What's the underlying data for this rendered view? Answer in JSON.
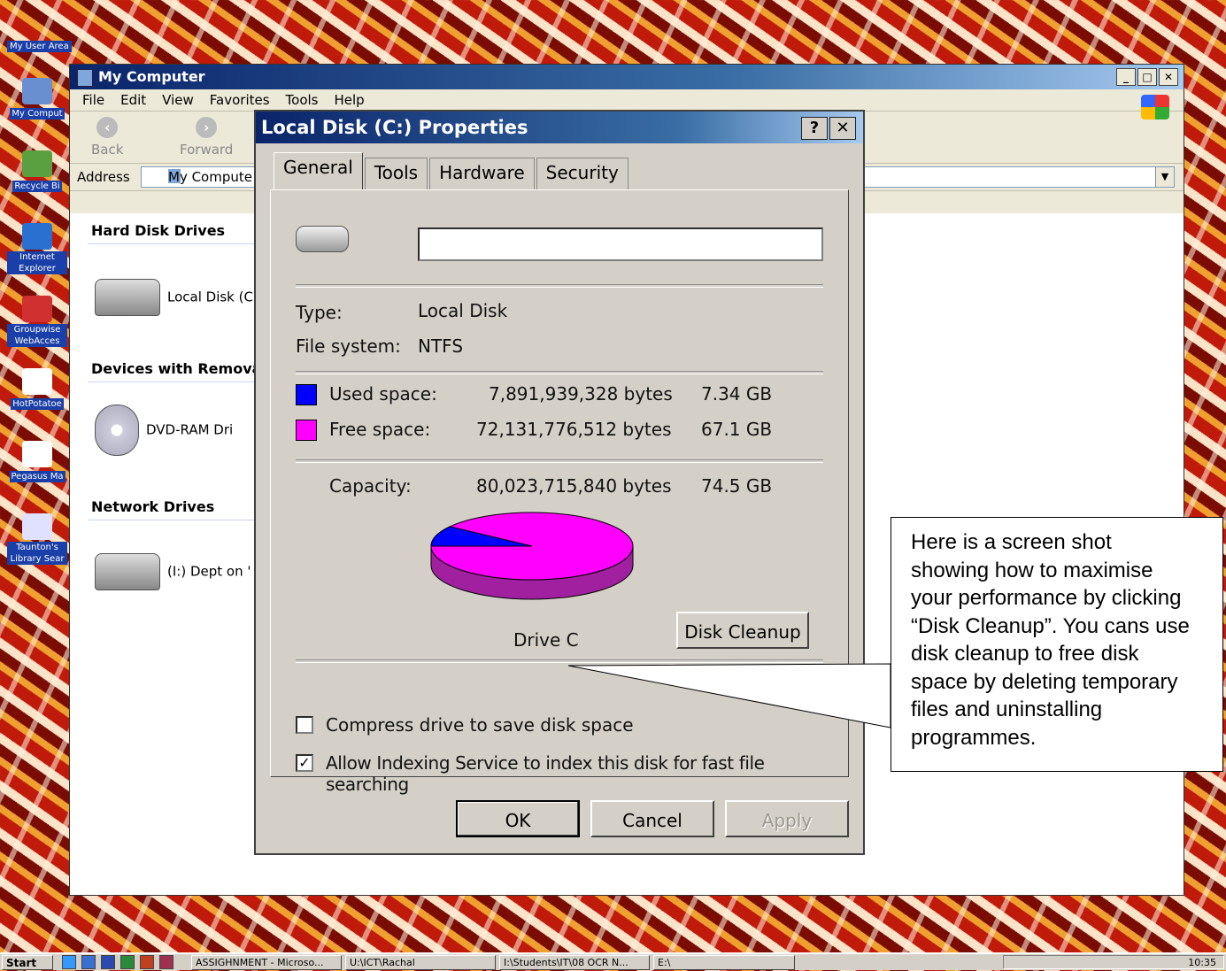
{
  "desktop": {
    "user_area": "My User Area",
    "icons": [
      {
        "label": "My Comput",
        "color": "#6a8fd0"
      },
      {
        "label": "Recycle Bi",
        "color": "#5aa040"
      },
      {
        "label": "Internet Explorer",
        "color": "#2a70d0"
      },
      {
        "label": "Groupwise WebAcces",
        "color": "#d03030"
      },
      {
        "label": "HotPotatoe",
        "color": "#ffffff"
      },
      {
        "label": "Pegasus Ma",
        "color": "#ffffff"
      },
      {
        "label": "Taunton's Library Sear",
        "color": "#e0e0ff"
      }
    ]
  },
  "explorer": {
    "title": "My Computer",
    "menu": [
      "File",
      "Edit",
      "View",
      "Favorites",
      "Tools",
      "Help"
    ],
    "toolbar": {
      "back": "Back",
      "forward": "Forward"
    },
    "address_label": "Address",
    "address_value": "My Compute",
    "groups": [
      {
        "heading": "Hard Disk Drives",
        "item": "Local Disk (C:"
      },
      {
        "heading": "Devices with Remova",
        "item": "DVD-RAM Dri"
      },
      {
        "heading": "Network Drives",
        "item": "(I:) Dept on '"
      }
    ]
  },
  "dialog": {
    "title": "Local Disk (C:) Properties",
    "help_btn": "?",
    "close_btn": "✕",
    "tabs": [
      "General",
      "Tools",
      "Hardware",
      "Security"
    ],
    "active_tab": "General",
    "name_value": "",
    "type_label": "Type:",
    "type_value": "Local Disk",
    "fs_label": "File system:",
    "fs_value": "NTFS",
    "used_label": "Used space:",
    "used_bytes": "7,891,939,328 bytes",
    "used_gb": "7.34 GB",
    "free_label": "Free space:",
    "free_bytes": "72,131,776,512 bytes",
    "free_gb": "67.1 GB",
    "capacity_label": "Capacity:",
    "capacity_bytes": "80,023,715,840 bytes",
    "capacity_gb": "74.5 GB",
    "drive_label": "Drive C",
    "cleanup_btn": "Disk Cleanup",
    "compress_label": "Compress drive to save disk space",
    "compress_checked": false,
    "index_label": "Allow Indexing Service to index this disk for fast file searching",
    "index_checked": true,
    "ok_btn": "OK",
    "cancel_btn": "Cancel",
    "apply_btn": "Apply",
    "colors": {
      "used": "#0000ff",
      "free": "#ff00ff",
      "free_side": "#a020a0"
    },
    "used_fraction": 0.0986
  },
  "callout": {
    "text": "Here is a screen shot\nshowing how to maximise\nyour performance by clicking\n“Disk Cleanup”. You cans use\ndisk cleanup to free disk\nspace by deleting temporary\nfiles and uninstalling\nprogrammes."
  },
  "taskbar": {
    "start": "Start",
    "tasks": [
      "ASSIGHNMENT - Microso...",
      "U:\\ICT\\Rachal",
      "I:\\Students\\IT\\08 OCR N...",
      "E:\\"
    ],
    "clock": "10:35"
  }
}
